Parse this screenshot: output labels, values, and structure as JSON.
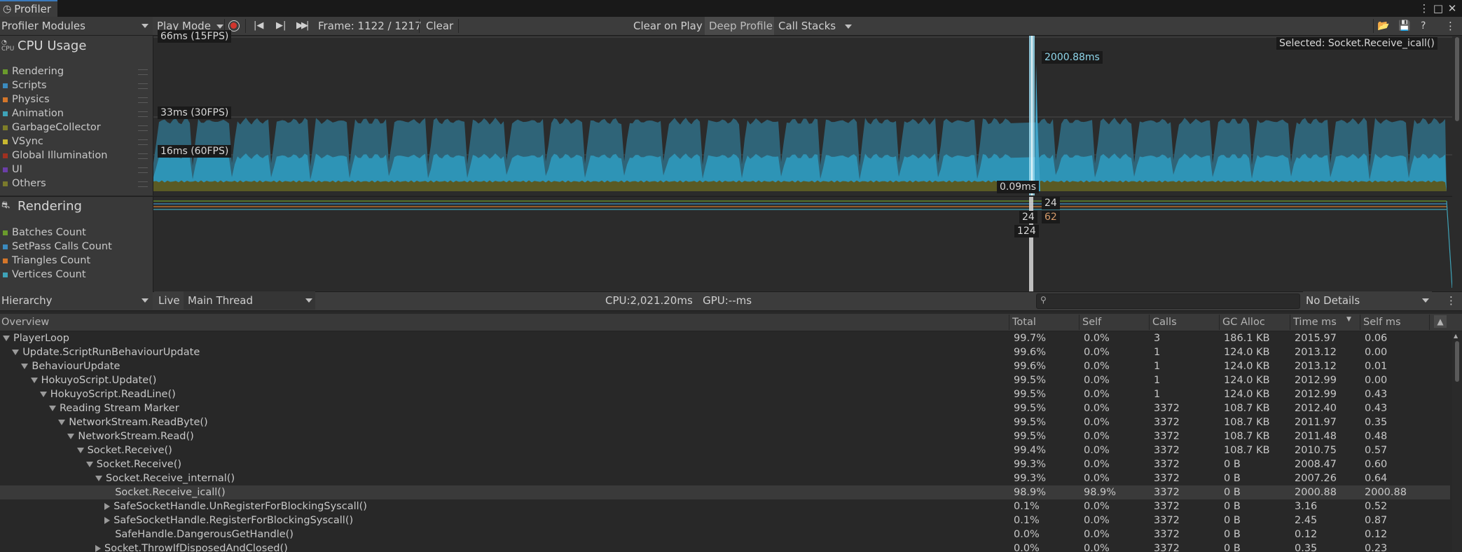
{
  "window": {
    "title": "Profiler",
    "more_icon": "kebab-menu-icon",
    "maximize_icon": "maximize-icon",
    "close_icon": "close-icon"
  },
  "toolbar": {
    "modules_dropdown": "Profiler Modules",
    "play_mode": "Play Mode",
    "frame": "Frame: 1122 / 1217",
    "clear": "Clear",
    "clear_on_play": "Clear on Play",
    "deep_profile": "Deep Profile",
    "call_stacks": "Call Stacks"
  },
  "cpu_module": {
    "title": "CPU Usage",
    "icon_text": "CPU",
    "legend": [
      {
        "label": "Rendering",
        "color": "#6a9a2c"
      },
      {
        "label": "Scripts",
        "color": "#3b8bbf"
      },
      {
        "label": "Physics",
        "color": "#d4762a"
      },
      {
        "label": "Animation",
        "color": "#3fa3b8"
      },
      {
        "label": "GarbageCollector",
        "color": "#7f7f28"
      },
      {
        "label": "VSync",
        "color": "#c8b830"
      },
      {
        "label": "Global Illumination",
        "color": "#a03020"
      },
      {
        "label": "UI",
        "color": "#6b3fa8"
      },
      {
        "label": "Others",
        "color": "#7a7a2c"
      }
    ],
    "labels": {
      "fps15": "66ms (15FPS)",
      "fps30": "33ms (30FPS)",
      "fps60": "16ms (60FPS)",
      "spike": "2000.88ms",
      "min": "0.09ms",
      "selected": "Selected: Socket.Receive_icall()"
    }
  },
  "rendering_module": {
    "title": "Rendering",
    "legend": [
      {
        "label": "Batches Count",
        "color": "#6a9a2c"
      },
      {
        "label": "SetPass Calls Count",
        "color": "#3b8bbf"
      },
      {
        "label": "Triangles Count",
        "color": "#d4762a"
      },
      {
        "label": "Vertices Count",
        "color": "#3fa3b8"
      }
    ],
    "values": {
      "a": "24",
      "b": "24",
      "c": "62",
      "d": "124"
    }
  },
  "hierarchy_bar": {
    "view": "Hierarchy",
    "live": "Live",
    "thread": "Main Thread",
    "stats": "CPU:2,021.20ms   GPU:--ms",
    "details": "No Details"
  },
  "columns": [
    "Overview",
    "Total",
    "Self",
    "Calls",
    "GC Alloc",
    "Time ms",
    "Self ms"
  ],
  "rows": [
    {
      "name": "PlayerLoop",
      "indent": 0,
      "exp": "down",
      "total": "99.7%",
      "self": "0.0%",
      "calls": "3",
      "gc": "186.1 KB",
      "time": "2015.97",
      "selfms": "0.06"
    },
    {
      "name": "Update.ScriptRunBehaviourUpdate",
      "indent": 1,
      "exp": "down",
      "total": "99.6%",
      "self": "0.0%",
      "calls": "1",
      "gc": "124.0 KB",
      "time": "2013.12",
      "selfms": "0.00"
    },
    {
      "name": "BehaviourUpdate",
      "indent": 2,
      "exp": "down",
      "total": "99.6%",
      "self": "0.0%",
      "calls": "1",
      "gc": "124.0 KB",
      "time": "2013.12",
      "selfms": "0.01"
    },
    {
      "name": "HokuyoScript.Update()",
      "indent": 3,
      "exp": "down",
      "total": "99.5%",
      "self": "0.0%",
      "calls": "1",
      "gc": "124.0 KB",
      "time": "2012.99",
      "selfms": "0.00"
    },
    {
      "name": "HokuyoScript.ReadLine()",
      "indent": 4,
      "exp": "down",
      "total": "99.5%",
      "self": "0.0%",
      "calls": "1",
      "gc": "124.0 KB",
      "time": "2012.99",
      "selfms": "0.43"
    },
    {
      "name": "Reading Stream Marker",
      "indent": 5,
      "exp": "down",
      "total": "99.5%",
      "self": "0.0%",
      "calls": "3372",
      "gc": "108.7 KB",
      "time": "2012.40",
      "selfms": "0.43"
    },
    {
      "name": "NetworkStream.ReadByte()",
      "indent": 6,
      "exp": "down",
      "total": "99.5%",
      "self": "0.0%",
      "calls": "3372",
      "gc": "108.7 KB",
      "time": "2011.97",
      "selfms": "0.35"
    },
    {
      "name": "NetworkStream.Read()",
      "indent": 7,
      "exp": "down",
      "total": "99.5%",
      "self": "0.0%",
      "calls": "3372",
      "gc": "108.7 KB",
      "time": "2011.48",
      "selfms": "0.48"
    },
    {
      "name": "Socket.Receive()",
      "indent": 8,
      "exp": "down",
      "total": "99.4%",
      "self": "0.0%",
      "calls": "3372",
      "gc": "108.7 KB",
      "time": "2010.75",
      "selfms": "0.57"
    },
    {
      "name": "Socket.Receive()",
      "indent": 9,
      "exp": "down",
      "total": "99.3%",
      "self": "0.0%",
      "calls": "3372",
      "gc": "0 B",
      "time": "2008.47",
      "selfms": "0.60"
    },
    {
      "name": "Socket.Receive_internal()",
      "indent": 10,
      "exp": "down",
      "total": "99.3%",
      "self": "0.0%",
      "calls": "3372",
      "gc": "0 B",
      "time": "2007.26",
      "selfms": "0.64"
    },
    {
      "name": "Socket.Receive_icall()",
      "indent": 11,
      "exp": "none",
      "total": "98.9%",
      "self": "98.9%",
      "calls": "3372",
      "gc": "0 B",
      "time": "2000.88",
      "selfms": "2000.88",
      "selected": true
    },
    {
      "name": "SafeSocketHandle.UnRegisterForBlockingSyscall()",
      "indent": 11,
      "exp": "right",
      "total": "0.1%",
      "self": "0.0%",
      "calls": "3372",
      "gc": "0 B",
      "time": "3.16",
      "selfms": "0.52"
    },
    {
      "name": "SafeSocketHandle.RegisterForBlockingSyscall()",
      "indent": 11,
      "exp": "right",
      "total": "0.1%",
      "self": "0.0%",
      "calls": "3372",
      "gc": "0 B",
      "time": "2.45",
      "selfms": "0.87"
    },
    {
      "name": "SafeHandle.DangerousGetHandle()",
      "indent": 11,
      "exp": "none",
      "total": "0.0%",
      "self": "0.0%",
      "calls": "3372",
      "gc": "0 B",
      "time": "0.12",
      "selfms": "0.12"
    },
    {
      "name": "Socket.ThrowIfDisposedAndClosed()",
      "indent": 10,
      "exp": "right",
      "total": "0.0%",
      "self": "0.0%",
      "calls": "3372",
      "gc": "0 B",
      "time": "0.35",
      "selfms": "0.23"
    }
  ]
}
